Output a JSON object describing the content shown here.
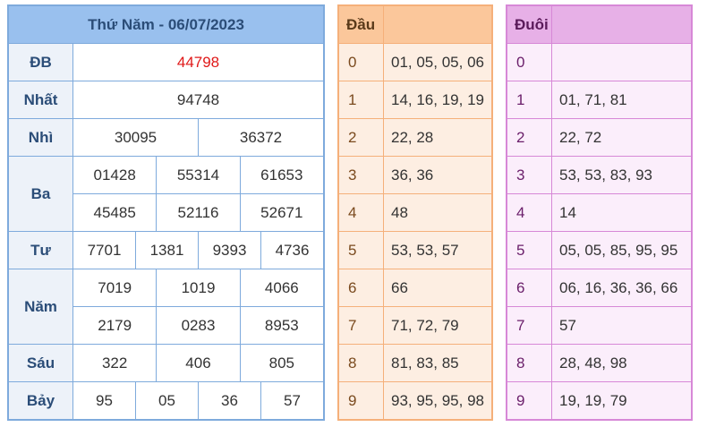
{
  "results": {
    "title": "Thứ Năm - 06/07/2023",
    "prizes": [
      {
        "label": "ĐB",
        "rows": [
          [
            "44798"
          ]
        ]
      },
      {
        "label": "Nhất",
        "rows": [
          [
            "94748"
          ]
        ]
      },
      {
        "label": "Nhì",
        "rows": [
          [
            "30095",
            "36372"
          ]
        ]
      },
      {
        "label": "Ba",
        "rows": [
          [
            "01428",
            "55314",
            "61653"
          ],
          [
            "45485",
            "52116",
            "52671"
          ]
        ]
      },
      {
        "label": "Tư",
        "rows": [
          [
            "7701",
            "1381",
            "9393",
            "4736"
          ]
        ]
      },
      {
        "label": "Năm",
        "rows": [
          [
            "7019",
            "1019",
            "4066"
          ],
          [
            "2179",
            "0283",
            "8953"
          ]
        ]
      },
      {
        "label": "Sáu",
        "rows": [
          [
            "322",
            "406",
            "805"
          ]
        ]
      },
      {
        "label": "Bảy",
        "rows": [
          [
            "95",
            "05",
            "36",
            "57"
          ]
        ]
      }
    ]
  },
  "dau": {
    "header": "Đầu",
    "header_value": "",
    "rows": [
      {
        "k": "0",
        "v": "01, 05, 05, 06"
      },
      {
        "k": "1",
        "v": "14, 16, 19, 19"
      },
      {
        "k": "2",
        "v": "22, 28"
      },
      {
        "k": "3",
        "v": "36, 36"
      },
      {
        "k": "4",
        "v": "48"
      },
      {
        "k": "5",
        "v": "53, 53, 57"
      },
      {
        "k": "6",
        "v": "66"
      },
      {
        "k": "7",
        "v": "71, 72, 79"
      },
      {
        "k": "8",
        "v": "81, 83, 85"
      },
      {
        "k": "9",
        "v": "93, 95, 95, 98"
      }
    ]
  },
  "duoi": {
    "header": "Đuôi",
    "header_value": "",
    "rows": [
      {
        "k": "0",
        "v": ""
      },
      {
        "k": "1",
        "v": "01, 71, 81"
      },
      {
        "k": "2",
        "v": "22, 72"
      },
      {
        "k": "3",
        "v": "53, 53, 83, 93"
      },
      {
        "k": "4",
        "v": "14"
      },
      {
        "k": "5",
        "v": "05, 05, 85, 95, 95"
      },
      {
        "k": "6",
        "v": "06, 16, 36, 36, 66"
      },
      {
        "k": "7",
        "v": "57"
      },
      {
        "k": "8",
        "v": "28, 48, 98"
      },
      {
        "k": "9",
        "v": "19, 19, 79"
      }
    ]
  },
  "colors": {
    "special_prize": "#e01818",
    "results_border": "#7eaadc",
    "results_header": "#99c0ee",
    "dau_border": "#f5b07a",
    "duoi_border": "#d788d7"
  }
}
